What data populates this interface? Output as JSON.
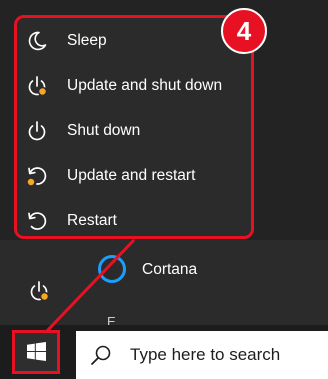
{
  "power_menu": {
    "items": [
      {
        "label": "Sleep",
        "icon": "moon-icon"
      },
      {
        "label": "Update and shut down",
        "icon": "power-update-icon"
      },
      {
        "label": "Shut down",
        "icon": "power-icon"
      },
      {
        "label": "Update and restart",
        "icon": "restart-update-icon"
      },
      {
        "label": "Restart",
        "icon": "restart-icon"
      }
    ]
  },
  "step_badge": "4",
  "start_menu": {
    "cortana_label": "Cortana",
    "partial_item_text": "E"
  },
  "taskbar": {
    "search_placeholder": "Type here to search"
  },
  "colors": {
    "highlight": "#e81123",
    "update_dot": "#f7a823",
    "cortana": "#1a9fff"
  }
}
